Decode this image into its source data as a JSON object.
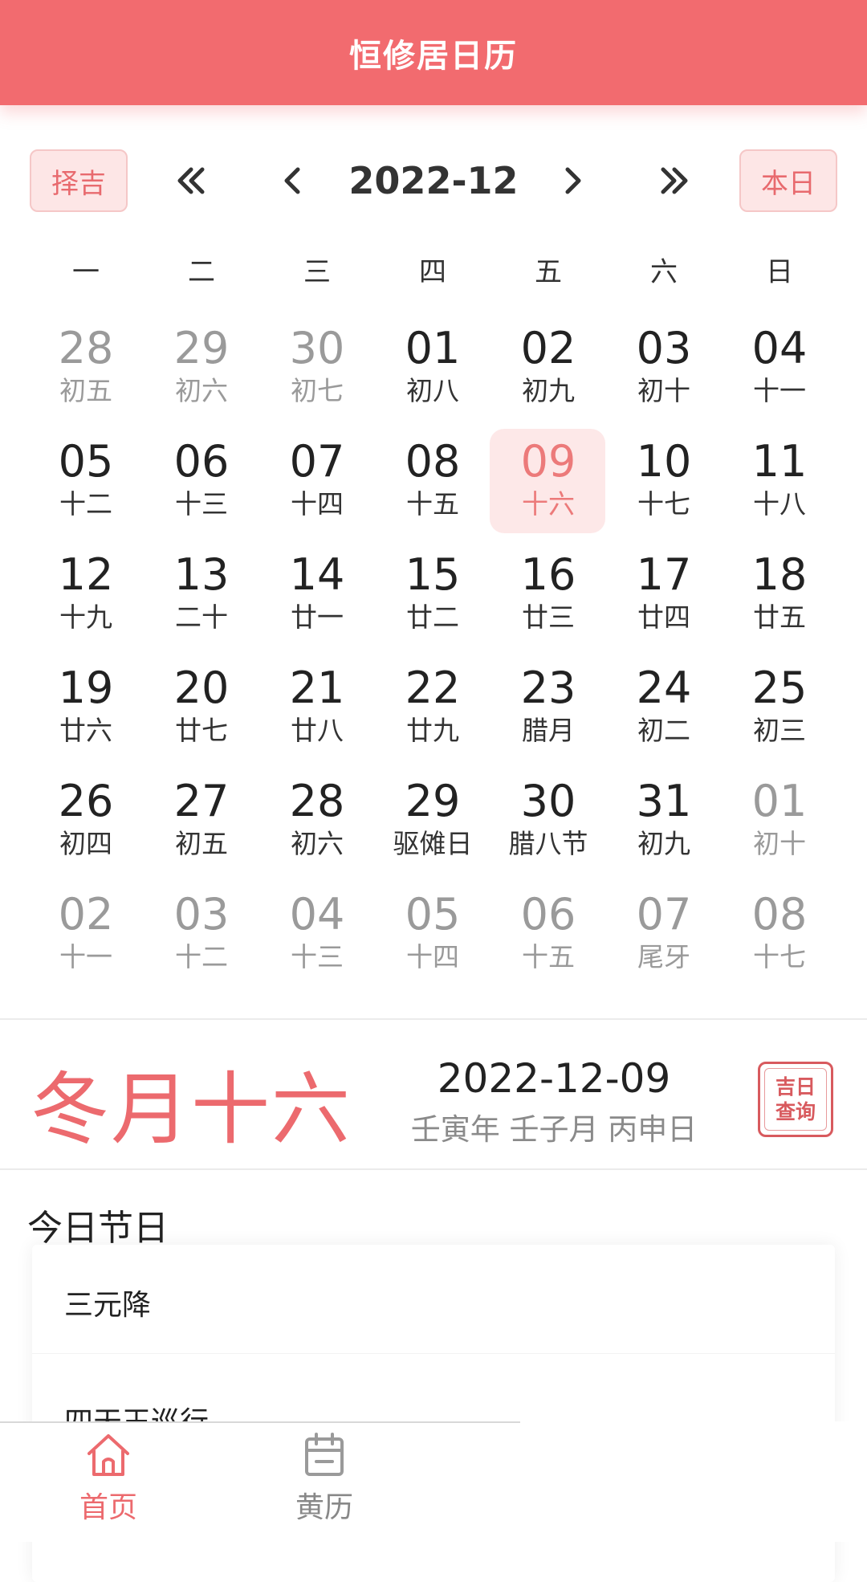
{
  "header": {
    "title": "恒修居日历"
  },
  "toolbar": {
    "left_button": "择吉",
    "month": "2022-12",
    "right_button": "本日"
  },
  "weekdays": [
    "一",
    "二",
    "三",
    "四",
    "五",
    "六",
    "日"
  ],
  "calendar": {
    "weeks": [
      [
        {
          "d": "28",
          "l": "初五",
          "o": true
        },
        {
          "d": "29",
          "l": "初六",
          "o": true
        },
        {
          "d": "30",
          "l": "初七",
          "o": true
        },
        {
          "d": "01",
          "l": "初八"
        },
        {
          "d": "02",
          "l": "初九"
        },
        {
          "d": "03",
          "l": "初十"
        },
        {
          "d": "04",
          "l": "十一"
        }
      ],
      [
        {
          "d": "05",
          "l": "十二"
        },
        {
          "d": "06",
          "l": "十三"
        },
        {
          "d": "07",
          "l": "十四"
        },
        {
          "d": "08",
          "l": "十五"
        },
        {
          "d": "09",
          "l": "十六",
          "sel": true
        },
        {
          "d": "10",
          "l": "十七"
        },
        {
          "d": "11",
          "l": "十八"
        }
      ],
      [
        {
          "d": "12",
          "l": "十九"
        },
        {
          "d": "13",
          "l": "二十"
        },
        {
          "d": "14",
          "l": "廿一"
        },
        {
          "d": "15",
          "l": "廿二"
        },
        {
          "d": "16",
          "l": "廿三"
        },
        {
          "d": "17",
          "l": "廿四"
        },
        {
          "d": "18",
          "l": "廿五"
        }
      ],
      [
        {
          "d": "19",
          "l": "廿六"
        },
        {
          "d": "20",
          "l": "廿七"
        },
        {
          "d": "21",
          "l": "廿八"
        },
        {
          "d": "22",
          "l": "廿九"
        },
        {
          "d": "23",
          "l": "腊月"
        },
        {
          "d": "24",
          "l": "初二"
        },
        {
          "d": "25",
          "l": "初三"
        }
      ],
      [
        {
          "d": "26",
          "l": "初四"
        },
        {
          "d": "27",
          "l": "初五"
        },
        {
          "d": "28",
          "l": "初六"
        },
        {
          "d": "29",
          "l": "驱傩日"
        },
        {
          "d": "30",
          "l": "腊八节"
        },
        {
          "d": "31",
          "l": "初九"
        },
        {
          "d": "01",
          "l": "初十",
          "o": true
        }
      ],
      [
        {
          "d": "02",
          "l": "十一",
          "o": true
        },
        {
          "d": "03",
          "l": "十二",
          "o": true
        },
        {
          "d": "04",
          "l": "十三",
          "o": true
        },
        {
          "d": "05",
          "l": "十四",
          "o": true
        },
        {
          "d": "06",
          "l": "十五",
          "o": true
        },
        {
          "d": "07",
          "l": "尾牙",
          "o": true
        },
        {
          "d": "08",
          "l": "十七",
          "o": true
        }
      ]
    ]
  },
  "day_info": {
    "lunar_date": "冬月十六",
    "solar_date": "2022-12-09",
    "ganzhi": "壬寅年 壬子月 丙申日",
    "seal_line1": "吉日",
    "seal_line2": "查询"
  },
  "festivals": {
    "title": "今日节日",
    "items": [
      "三元降",
      "四天王巡行"
    ]
  },
  "tabbar": {
    "tabs": [
      {
        "label": "首页",
        "icon": "home-icon",
        "active": true
      },
      {
        "label": "黄历",
        "icon": "calendar-icon",
        "active": false
      }
    ]
  },
  "colors": {
    "accent": "#f26b6f",
    "selected_bg": "#fde8e8",
    "muted": "#9a9a9a"
  }
}
